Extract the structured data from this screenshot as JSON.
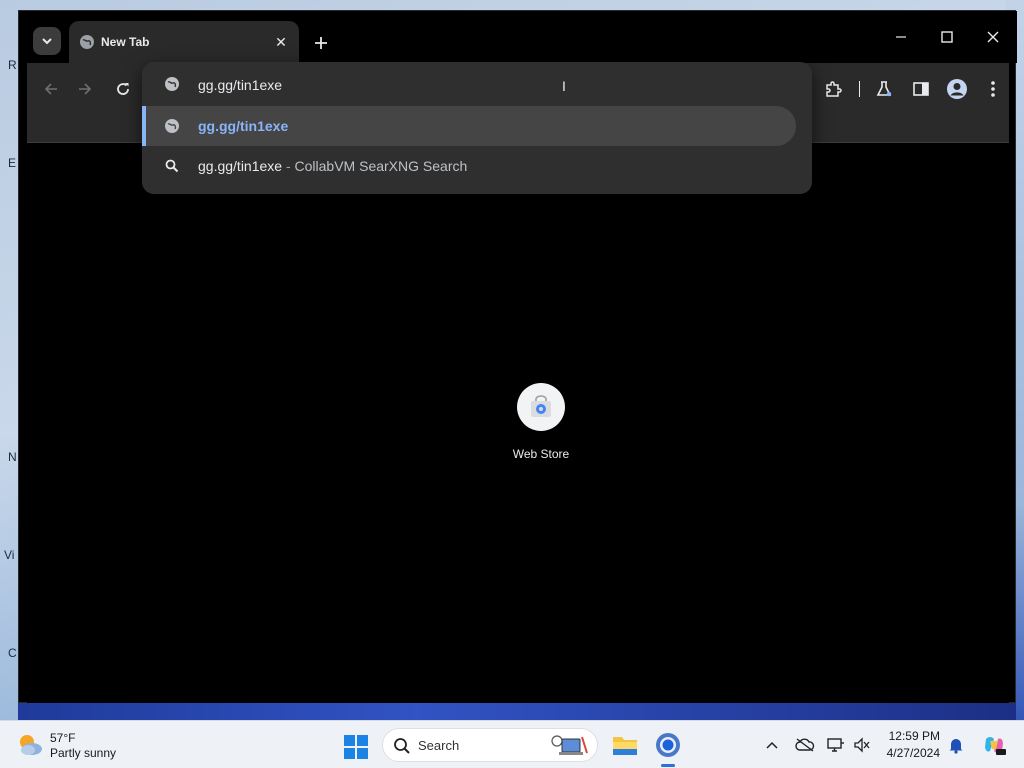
{
  "browser": {
    "tab": {
      "title": "New Tab"
    },
    "omnibox": {
      "value": "gg.gg/tin1exe",
      "suggestions": [
        {
          "text": "gg.gg/tin1exe",
          "description": "",
          "type": "url",
          "icon": "globe-icon",
          "selected": true
        },
        {
          "text": "gg.gg/tin1exe",
          "separator": "-",
          "description": "CollabVM SearXNG Search",
          "type": "search",
          "icon": "search-icon",
          "selected": false
        }
      ]
    },
    "shortcuts": [
      {
        "label": "Web Store",
        "icon": "web-store-icon"
      }
    ],
    "colors": {
      "accent": "#8ab4f8",
      "toolbar": "#2a2a2a",
      "page": "#000000"
    }
  },
  "taskbar": {
    "weather": {
      "temp": "57°F",
      "desc": "Partly sunny"
    },
    "search": {
      "label": "Search"
    },
    "clock": {
      "time": "12:59 PM",
      "date": "4/27/2024"
    }
  },
  "desktop": {
    "edge_letters": [
      "R",
      "E",
      "N",
      "Vi",
      "C"
    ]
  }
}
